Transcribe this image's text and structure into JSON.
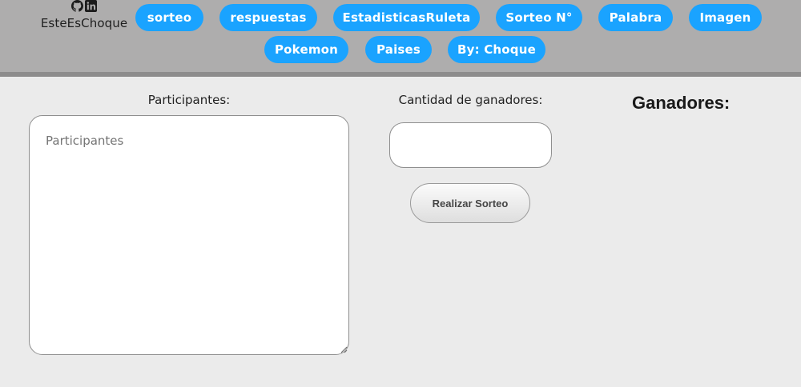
{
  "brand": {
    "name": "EsteEsChoque",
    "icons": [
      "github-icon",
      "linkedin-icon"
    ]
  },
  "nav": {
    "row1": [
      "sorteo",
      "respuestas",
      "EstadisticasRuleta",
      "Sorteo N°",
      "Palabra",
      "Imagen"
    ],
    "row2": [
      "Pokemon",
      "Paises",
      "By: Choque"
    ]
  },
  "form": {
    "participants_label": "Participantes:",
    "participants_placeholder": "Participantes",
    "participants_value": "",
    "count_label": "Cantidad de ganadores:",
    "count_value": "",
    "draw_button": "Realizar Sorteo"
  },
  "results": {
    "title": "Ganadores:"
  },
  "colors": {
    "header_bg": "#aeadad",
    "nav_button": "#1aa3ff",
    "page_bg": "#ebebeb"
  }
}
